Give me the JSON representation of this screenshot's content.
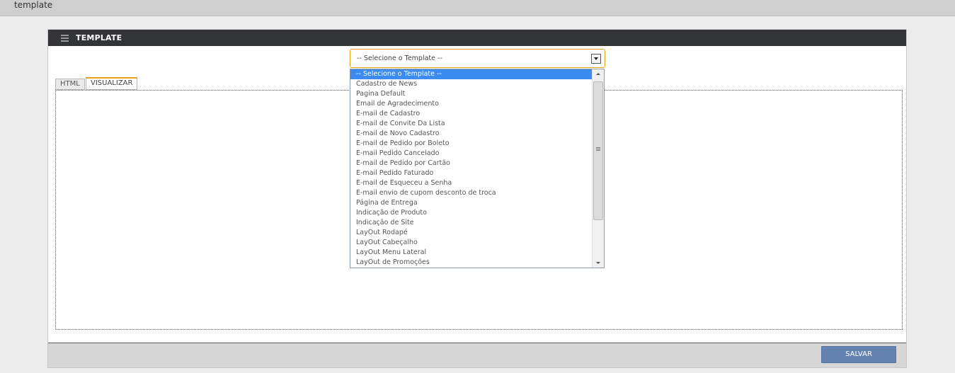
{
  "breadcrumb": "template",
  "panel": {
    "title": "TEMPLATE"
  },
  "template_select": {
    "value": "-- Selecione o Template --",
    "options": [
      "-- Selecione o Template --",
      "Cadastro de News",
      "Pagina Default",
      "Email de Agradecimento",
      "E-mail de Cadastro",
      "E-mail de Convite Da Lista",
      "E-mail de Novo Cadastro",
      "E-mail de Pedido por Boleto",
      "E-mail Pedido Cancelado",
      "E-mail de Pedido por Cartão",
      "E-mail Pedido Faturado",
      "E-mail de Esqueceu a Senha",
      "E-mail envio de cupom desconto de troca",
      "Página de Entrega",
      "Indicação de Produto",
      "Indicação de Site",
      "LayOut Rodapé",
      "LayOut Cabeçalho",
      "LayOut Menu Lateral",
      "LayOut de Promoções"
    ]
  },
  "tabs": {
    "html": "HTML",
    "visualizar": "VISUALIZAR"
  },
  "footer": {
    "save_label": "SALVAR"
  },
  "colors": {
    "accent": "#e3a21a",
    "header": "#333438",
    "button": "#6582b1",
    "selected_option": "#3b8bf0"
  }
}
